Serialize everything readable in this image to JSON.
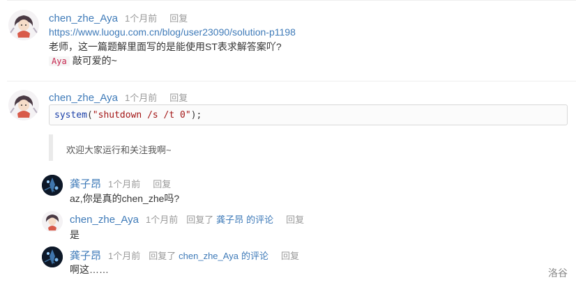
{
  "comments": [
    {
      "author": "chen_zhe_Aya",
      "time": "1个月前",
      "reply_label": "回复",
      "link": "https://www.luogu.com.cn/blog/user23090/solution-p1198",
      "line": "老师，这一篇题解里面写的是能使用ST表求解答案吖?",
      "tag": "Aya",
      "tag_text": "敲可爱的~"
    },
    {
      "author": "chen_zhe_Aya",
      "time": "1个月前",
      "reply_label": "回复",
      "code": {
        "fn": "system",
        "open": "(",
        "str": "\"shutdown /s /t 0\"",
        "close": ");"
      },
      "quote": "欢迎大家运行和关注我啊~",
      "replies": [
        {
          "author": "龚子昂",
          "time": "1个月前",
          "reply_label": "回复",
          "text": "az,你是真的chen_zhe吗?"
        },
        {
          "author": "chen_zhe_Aya",
          "time": "1个月前",
          "replied_to_label": "回复了",
          "replied_to_name": "龚子昂",
          "replied_to_suffix": "的评论",
          "reply_label": "回复",
          "text": "是"
        },
        {
          "author": "龚子昂",
          "time": "1个月前",
          "replied_to_label": "回复了",
          "replied_to_name": "chen_zhe_Aya",
          "replied_to_suffix": "的评论",
          "reply_label": "回复",
          "text": "啊这……"
        }
      ]
    }
  ],
  "footer": "洛谷",
  "icons": {
    "anime_avatar": "anime-girl-avatar-icon",
    "dark_avatar": "dark-scenery-avatar-icon"
  },
  "colors": {
    "author": "#3e7ab8",
    "meta": "#999999",
    "code_fn": "#1a3fa8",
    "code_str": "#a31515",
    "tag": "#c7254e"
  }
}
